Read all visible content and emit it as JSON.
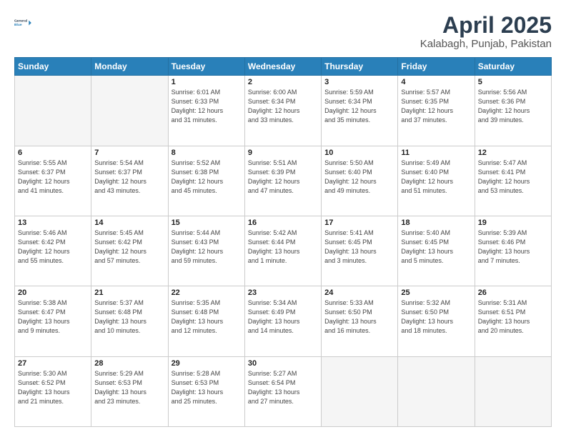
{
  "header": {
    "logo_line1": "General",
    "logo_line2": "Blue",
    "title": "April 2025",
    "subtitle": "Kalabagh, Punjab, Pakistan"
  },
  "calendar": {
    "headers": [
      "Sunday",
      "Monday",
      "Tuesday",
      "Wednesday",
      "Thursday",
      "Friday",
      "Saturday"
    ],
    "rows": [
      [
        {
          "day": "",
          "info": ""
        },
        {
          "day": "",
          "info": ""
        },
        {
          "day": "1",
          "info": "Sunrise: 6:01 AM\nSunset: 6:33 PM\nDaylight: 12 hours\nand 31 minutes."
        },
        {
          "day": "2",
          "info": "Sunrise: 6:00 AM\nSunset: 6:34 PM\nDaylight: 12 hours\nand 33 minutes."
        },
        {
          "day": "3",
          "info": "Sunrise: 5:59 AM\nSunset: 6:34 PM\nDaylight: 12 hours\nand 35 minutes."
        },
        {
          "day": "4",
          "info": "Sunrise: 5:57 AM\nSunset: 6:35 PM\nDaylight: 12 hours\nand 37 minutes."
        },
        {
          "day": "5",
          "info": "Sunrise: 5:56 AM\nSunset: 6:36 PM\nDaylight: 12 hours\nand 39 minutes."
        }
      ],
      [
        {
          "day": "6",
          "info": "Sunrise: 5:55 AM\nSunset: 6:37 PM\nDaylight: 12 hours\nand 41 minutes."
        },
        {
          "day": "7",
          "info": "Sunrise: 5:54 AM\nSunset: 6:37 PM\nDaylight: 12 hours\nand 43 minutes."
        },
        {
          "day": "8",
          "info": "Sunrise: 5:52 AM\nSunset: 6:38 PM\nDaylight: 12 hours\nand 45 minutes."
        },
        {
          "day": "9",
          "info": "Sunrise: 5:51 AM\nSunset: 6:39 PM\nDaylight: 12 hours\nand 47 minutes."
        },
        {
          "day": "10",
          "info": "Sunrise: 5:50 AM\nSunset: 6:40 PM\nDaylight: 12 hours\nand 49 minutes."
        },
        {
          "day": "11",
          "info": "Sunrise: 5:49 AM\nSunset: 6:40 PM\nDaylight: 12 hours\nand 51 minutes."
        },
        {
          "day": "12",
          "info": "Sunrise: 5:47 AM\nSunset: 6:41 PM\nDaylight: 12 hours\nand 53 minutes."
        }
      ],
      [
        {
          "day": "13",
          "info": "Sunrise: 5:46 AM\nSunset: 6:42 PM\nDaylight: 12 hours\nand 55 minutes."
        },
        {
          "day": "14",
          "info": "Sunrise: 5:45 AM\nSunset: 6:42 PM\nDaylight: 12 hours\nand 57 minutes."
        },
        {
          "day": "15",
          "info": "Sunrise: 5:44 AM\nSunset: 6:43 PM\nDaylight: 12 hours\nand 59 minutes."
        },
        {
          "day": "16",
          "info": "Sunrise: 5:42 AM\nSunset: 6:44 PM\nDaylight: 13 hours\nand 1 minute."
        },
        {
          "day": "17",
          "info": "Sunrise: 5:41 AM\nSunset: 6:45 PM\nDaylight: 13 hours\nand 3 minutes."
        },
        {
          "day": "18",
          "info": "Sunrise: 5:40 AM\nSunset: 6:45 PM\nDaylight: 13 hours\nand 5 minutes."
        },
        {
          "day": "19",
          "info": "Sunrise: 5:39 AM\nSunset: 6:46 PM\nDaylight: 13 hours\nand 7 minutes."
        }
      ],
      [
        {
          "day": "20",
          "info": "Sunrise: 5:38 AM\nSunset: 6:47 PM\nDaylight: 13 hours\nand 9 minutes."
        },
        {
          "day": "21",
          "info": "Sunrise: 5:37 AM\nSunset: 6:48 PM\nDaylight: 13 hours\nand 10 minutes."
        },
        {
          "day": "22",
          "info": "Sunrise: 5:35 AM\nSunset: 6:48 PM\nDaylight: 13 hours\nand 12 minutes."
        },
        {
          "day": "23",
          "info": "Sunrise: 5:34 AM\nSunset: 6:49 PM\nDaylight: 13 hours\nand 14 minutes."
        },
        {
          "day": "24",
          "info": "Sunrise: 5:33 AM\nSunset: 6:50 PM\nDaylight: 13 hours\nand 16 minutes."
        },
        {
          "day": "25",
          "info": "Sunrise: 5:32 AM\nSunset: 6:50 PM\nDaylight: 13 hours\nand 18 minutes."
        },
        {
          "day": "26",
          "info": "Sunrise: 5:31 AM\nSunset: 6:51 PM\nDaylight: 13 hours\nand 20 minutes."
        }
      ],
      [
        {
          "day": "27",
          "info": "Sunrise: 5:30 AM\nSunset: 6:52 PM\nDaylight: 13 hours\nand 21 minutes."
        },
        {
          "day": "28",
          "info": "Sunrise: 5:29 AM\nSunset: 6:53 PM\nDaylight: 13 hours\nand 23 minutes."
        },
        {
          "day": "29",
          "info": "Sunrise: 5:28 AM\nSunset: 6:53 PM\nDaylight: 13 hours\nand 25 minutes."
        },
        {
          "day": "30",
          "info": "Sunrise: 5:27 AM\nSunset: 6:54 PM\nDaylight: 13 hours\nand 27 minutes."
        },
        {
          "day": "",
          "info": ""
        },
        {
          "day": "",
          "info": ""
        },
        {
          "day": "",
          "info": ""
        }
      ]
    ]
  }
}
